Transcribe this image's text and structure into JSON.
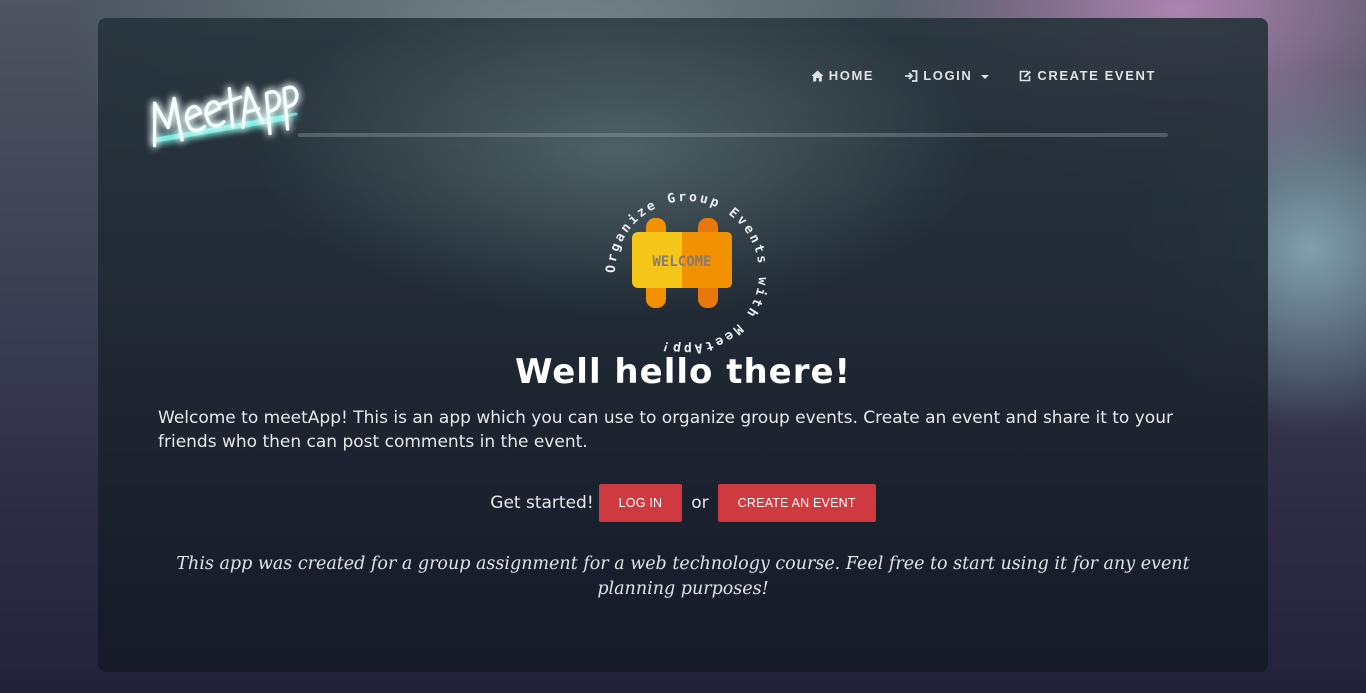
{
  "brand": {
    "logo_text": "MeetApp"
  },
  "nav": {
    "home": "HOME",
    "login": "LOGIN",
    "create_event": "CREATE EVENT"
  },
  "badge": {
    "sign_text": "WELCOME",
    "ring_text": "Organize Group Events with MeetApp!"
  },
  "main": {
    "title": "Well hello there!",
    "intro": "Welcome to meetApp! This is an app which you can use to organize group events. Create an event and share it to your friends who then can post comments in the event.",
    "get_started": "Get started!",
    "login_button": "LOG IN",
    "or": "or",
    "create_button": "CREATE AN EVENT",
    "note": "This app was created for a group assignment for a web technology course. Feel free to start using it for any event planning purposes!"
  },
  "colors": {
    "accent": "#cf3a40",
    "logo_glow": "#2fe0d2",
    "sign_yellow": "#f5c518",
    "sign_orange": "#f39200",
    "post_orange": "#e8770e"
  },
  "icons": [
    "home-icon",
    "login-icon",
    "edit-icon",
    "chevron-down-icon"
  ]
}
